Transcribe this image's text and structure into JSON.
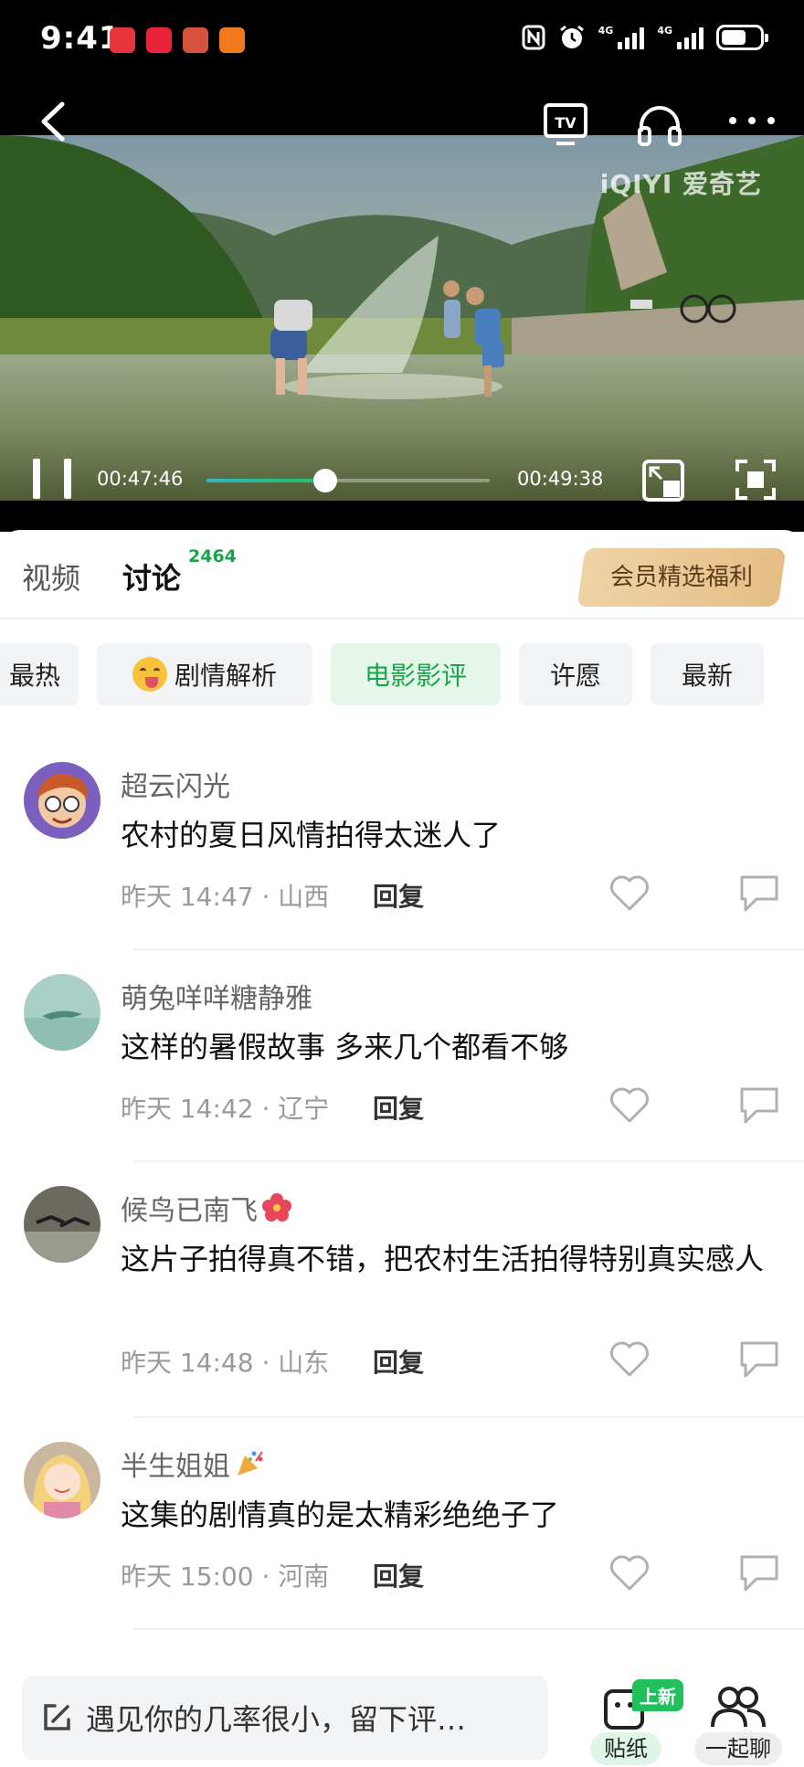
{
  "status_bar": {
    "time": "9:41",
    "app_icons": [
      {
        "name": "huawei-video-icon",
        "color": "#e8353b"
      },
      {
        "name": "xiaohongshu-icon",
        "color": "#e8233a"
      },
      {
        "name": "game-app-icon",
        "color": "#d7533c"
      },
      {
        "name": "orange-app-icon",
        "color": "#f07a1c"
      }
    ],
    "signal_label_1": "4G",
    "signal_label_2": "4G"
  },
  "player": {
    "watermark": "iQIYI 爱奇艺",
    "current_time": "00:47:46",
    "duration": "00:49:38",
    "progress": 0.42
  },
  "tabs": {
    "video": "视频",
    "discussion": "讨论",
    "discussion_count": "2464",
    "vip_button": "会员精选福利"
  },
  "filter_chips": [
    {
      "label": "最热",
      "active": false
    },
    {
      "label": "剧情解析",
      "active": false,
      "icon": "face-emoji-icon"
    },
    {
      "label": "电影影评",
      "active": true
    },
    {
      "label": "许愿",
      "active": false
    },
    {
      "label": "最新",
      "active": false
    }
  ],
  "reply_label": "回复",
  "comments": [
    {
      "user": "超云闪光",
      "text": "农村的夏日风情拍得太迷人了",
      "time": "昨天 14:47 · 山西",
      "badge": null
    },
    {
      "user": "萌兔咩咩糖静雅",
      "text": "这样的暑假故事 多来几个都看不够",
      "time": "昨天 14:42 · 辽宁",
      "badge": null
    },
    {
      "user": "候鸟已南飞",
      "text": "这片子拍得真不错，把农村生活拍得特别真实感人",
      "time": "昨天 14:48 · 山东",
      "badge": "hibiscus-emoji-icon"
    },
    {
      "user": "半生姐姐",
      "text": "这集的剧情真的是太精彩绝绝子了",
      "time": "昨天 15:00 · 河南",
      "badge": "party-popper-emoji-icon"
    }
  ],
  "bottom_bar": {
    "input_placeholder": "遇见你的几率很小，留下评…",
    "sticker_badge": "上新",
    "sticker_label": "贴纸",
    "together_label": "一起聊"
  },
  "colors": {
    "accent_green": "#1aa54c",
    "vip_gold": "#e5be86"
  }
}
